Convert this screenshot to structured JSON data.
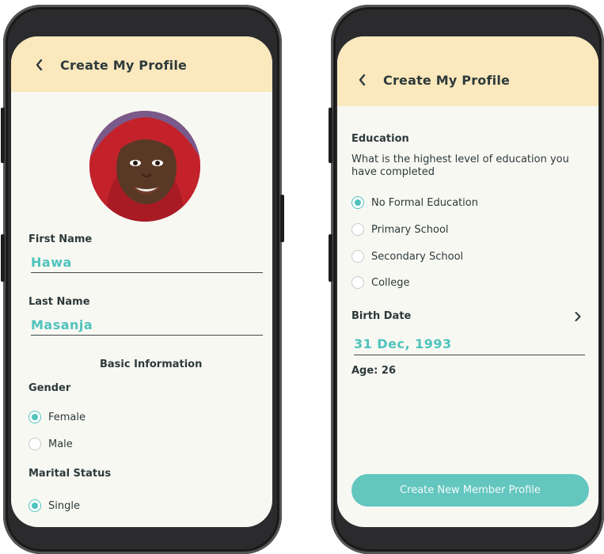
{
  "left_screen": {
    "header": {
      "title": "Create My Profile"
    },
    "first_name": {
      "label": "First Name",
      "value": "Hawa"
    },
    "last_name": {
      "label": "Last Name",
      "value": "Masanja"
    },
    "section_title": "Basic Information",
    "gender": {
      "label": "Gender",
      "options": [
        {
          "label": "Female",
          "selected": true
        },
        {
          "label": "Male",
          "selected": false
        }
      ]
    },
    "marital_status": {
      "label": "Marital Status",
      "options": [
        {
          "label": "Single",
          "selected": true
        }
      ]
    }
  },
  "right_screen": {
    "header": {
      "title": "Create My Profile"
    },
    "education": {
      "label": "Education",
      "question": "What is the highest level of education you have completed",
      "options": [
        {
          "label": "No Formal Education",
          "selected": true
        },
        {
          "label": "Primary School",
          "selected": false
        },
        {
          "label": "Secondary School",
          "selected": false
        },
        {
          "label": "College",
          "selected": false
        }
      ]
    },
    "birth_date": {
      "label": "Birth Date",
      "value": "31 Dec, 1993"
    },
    "age": "Age: 26",
    "cta_button": "Create New Member Profile"
  },
  "colors": {
    "header_bg": "#fbe8bd",
    "accent": "#4fc3bc",
    "button_bg": "#63c6bf",
    "screen_bg": "#f8f8f3",
    "phone_frame": "#2b2b2d"
  },
  "icons": [
    "chevron-left-icon",
    "chevron-right-icon",
    "radio-icon"
  ]
}
